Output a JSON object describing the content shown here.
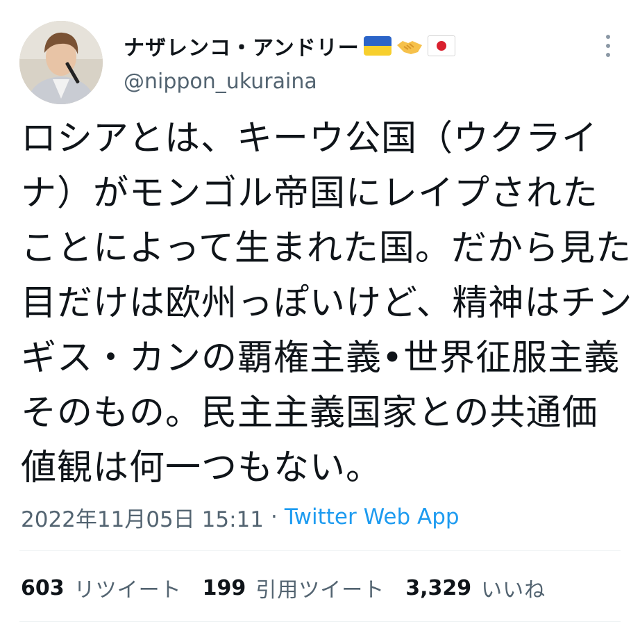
{
  "user": {
    "display_name": "ナザレンコ・アンドリー",
    "handle": "@nippon_ukuraina",
    "name_emojis": [
      "flag-ukraine",
      "handshake",
      "flag-japan"
    ]
  },
  "tweet": {
    "lines": [
      "ロシアとは、キーウ公国（ウクライ",
      "ナ）がモンゴル帝国にレイプされた",
      "ことによって生まれた国。だから見た",
      "目だけは欧州っぽいけど、精神はチン",
      "ギス・カンの覇権主義•世界征服主義",
      "そのもの。民主主義国家との共通価",
      "値観は何一つもない。"
    ]
  },
  "meta": {
    "timestamp": "2022年11月05日 15:11",
    "separator": "·",
    "source": "Twitter Web App"
  },
  "stats": {
    "retweets": {
      "count": "603",
      "label": "リツイート"
    },
    "quotes": {
      "count": "199",
      "label": "引用ツイート"
    },
    "likes": {
      "count": "3,329",
      "label": "いいね"
    }
  },
  "colors": {
    "text": "#0f1419",
    "secondary": "#536471",
    "link": "#1d9bf0",
    "divider": "#eff3f4"
  }
}
